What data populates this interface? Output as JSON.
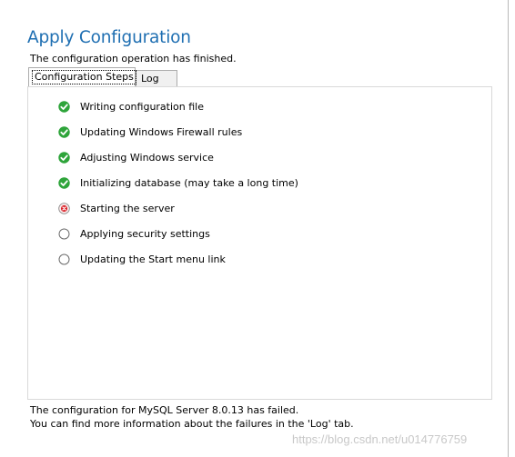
{
  "header": {
    "title": "Apply Configuration",
    "subtitle": "The configuration operation has finished."
  },
  "tabs": [
    {
      "label": "Configuration Steps",
      "active": true
    },
    {
      "label": "Log",
      "active": false
    }
  ],
  "steps": [
    {
      "label": "Writing configuration file",
      "status": "success",
      "icon": "check-circle-icon"
    },
    {
      "label": "Updating Windows Firewall rules",
      "status": "success",
      "icon": "check-circle-icon"
    },
    {
      "label": "Adjusting Windows service",
      "status": "success",
      "icon": "check-circle-icon"
    },
    {
      "label": "Initializing database (may take a long time)",
      "status": "success",
      "icon": "check-circle-icon"
    },
    {
      "label": "Starting the server",
      "status": "failed",
      "icon": "error-circle-icon"
    },
    {
      "label": "Applying security settings",
      "status": "pending",
      "icon": "empty-circle-icon"
    },
    {
      "label": "Updating the Start menu link",
      "status": "pending",
      "icon": "empty-circle-icon"
    }
  ],
  "footer": {
    "line1": "The configuration for MySQL Server 8.0.13 has failed.",
    "line2": "You can find more information about the failures in the 'Log' tab."
  },
  "watermark": "https://blog.csdn.net/u014776759",
  "colors": {
    "title": "#1f6fb2",
    "success": "#2ea43a",
    "failed": "#d9232a",
    "pending": "#6d6d6d"
  }
}
